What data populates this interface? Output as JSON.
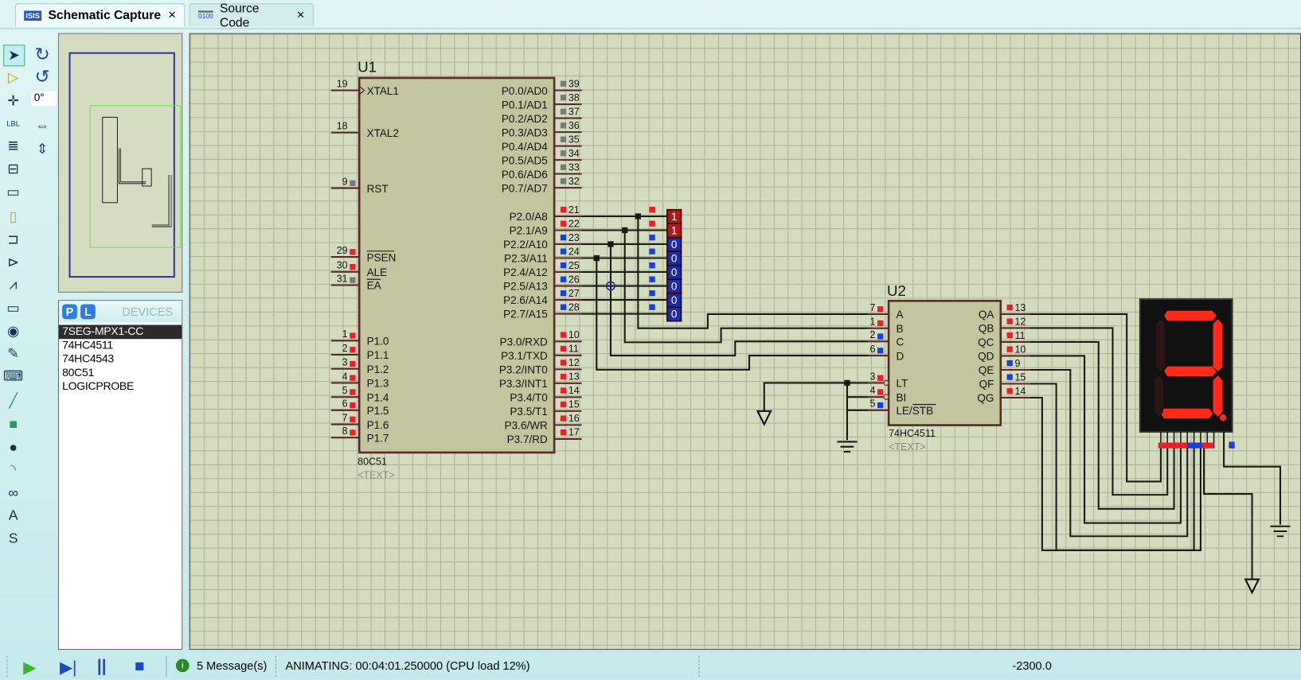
{
  "tabs": [
    {
      "label": "Schematic Capture",
      "icon": "isis-icon",
      "active": true
    },
    {
      "label": "Source Code",
      "icon": "source-code-icon",
      "active": false
    }
  ],
  "tab_close": "×",
  "rotation": "0°",
  "devices": {
    "title": "DEVICES",
    "p_label": "P",
    "l_label": "L",
    "items": [
      "7SEG-MPX1-CC",
      "74HC4511",
      "74HC4543",
      "80C51",
      "LOGICPROBE"
    ],
    "selected": "7SEG-MPX1-CC"
  },
  "toolbar": [
    "selection-mode",
    "component-mode",
    "junction-dot",
    "wire-label",
    "text-script",
    "buses",
    "subcircuit",
    "terminals",
    "device-pins",
    "graph",
    "tape-recorder",
    "generator",
    "voltage-probe",
    "virtual-instruments",
    "line-2d",
    "box-2d",
    "circle-2d",
    "arc-2d",
    "closed-path-2d",
    "text-2d",
    "symbol-2d",
    "marker-2d"
  ],
  "colors": {
    "high": "#e8202a",
    "low": "#1a3ee0",
    "float": "#7a7a7a",
    "segment_on": "#ff2a1a",
    "segment_off": "#2a1414"
  },
  "schematic": {
    "u1": {
      "ref": "U1",
      "part": "80C51",
      "text": "<TEXT>",
      "left_pins": [
        {
          "num": "19",
          "name": "XTAL1",
          "state": "none"
        },
        {
          "num": "18",
          "name": "XTAL2",
          "state": "none"
        },
        {
          "num": "9",
          "name": "RST",
          "state": "float"
        },
        {
          "num": "29",
          "name": "PSEN",
          "state": "high",
          "overline": true
        },
        {
          "num": "30",
          "name": "ALE",
          "state": "high"
        },
        {
          "num": "31",
          "name": "EA",
          "state": "float",
          "overline": true
        },
        {
          "num": "1",
          "name": "P1.0",
          "state": "high"
        },
        {
          "num": "2",
          "name": "P1.1",
          "state": "high"
        },
        {
          "num": "3",
          "name": "P1.2",
          "state": "high"
        },
        {
          "num": "4",
          "name": "P1.3",
          "state": "high"
        },
        {
          "num": "5",
          "name": "P1.4",
          "state": "high"
        },
        {
          "num": "6",
          "name": "P1.5",
          "state": "high"
        },
        {
          "num": "7",
          "name": "P1.6",
          "state": "high"
        },
        {
          "num": "8",
          "name": "P1.7",
          "state": "high"
        }
      ],
      "right_pins": [
        {
          "num": "39",
          "name": "P0.0/AD0",
          "state": "float"
        },
        {
          "num": "38",
          "name": "P0.1/AD1",
          "state": "float"
        },
        {
          "num": "37",
          "name": "P0.2/AD2",
          "state": "float"
        },
        {
          "num": "36",
          "name": "P0.3/AD3",
          "state": "float"
        },
        {
          "num": "35",
          "name": "P0.4/AD4",
          "state": "float"
        },
        {
          "num": "34",
          "name": "P0.5/AD5",
          "state": "float"
        },
        {
          "num": "33",
          "name": "P0.6/AD6",
          "state": "float"
        },
        {
          "num": "32",
          "name": "P0.7/AD7",
          "state": "float"
        },
        {
          "num": "21",
          "name": "P2.0/A8",
          "state": "high"
        },
        {
          "num": "22",
          "name": "P2.1/A9",
          "state": "high"
        },
        {
          "num": "23",
          "name": "P2.2/A10",
          "state": "low"
        },
        {
          "num": "24",
          "name": "P2.3/A11",
          "state": "low"
        },
        {
          "num": "25",
          "name": "P2.4/A12",
          "state": "low"
        },
        {
          "num": "26",
          "name": "P2.5/A13",
          "state": "low"
        },
        {
          "num": "27",
          "name": "P2.6/A14",
          "state": "low"
        },
        {
          "num": "28",
          "name": "P2.7/A15",
          "state": "low"
        },
        {
          "num": "10",
          "name": "P3.0/RXD",
          "state": "high"
        },
        {
          "num": "11",
          "name": "P3.1/TXD",
          "state": "high"
        },
        {
          "num": "12",
          "name": "P3.2/INT0",
          "state": "high"
        },
        {
          "num": "13",
          "name": "P3.3/INT1",
          "state": "high"
        },
        {
          "num": "14",
          "name": "P3.4/T0",
          "state": "high"
        },
        {
          "num": "15",
          "name": "P3.5/T1",
          "state": "high"
        },
        {
          "num": "16",
          "name": "P3.6/WR",
          "state": "high"
        },
        {
          "num": "17",
          "name": "P3.7/RD",
          "state": "high"
        }
      ]
    },
    "probes": [
      "1",
      "1",
      "0",
      "0",
      "0",
      "0",
      "0",
      "0"
    ],
    "u2": {
      "ref": "U2",
      "part": "74HC4511",
      "text": "<TEXT>",
      "left_pins": [
        {
          "num": "7",
          "name": "A",
          "state": "high"
        },
        {
          "num": "1",
          "name": "B",
          "state": "high"
        },
        {
          "num": "2",
          "name": "C",
          "state": "low"
        },
        {
          "num": "6",
          "name": "D",
          "state": "low"
        },
        {
          "num": "3",
          "name": "LT",
          "state": "high"
        },
        {
          "num": "4",
          "name": "BI",
          "state": "high"
        },
        {
          "num": "5",
          "name": "LE/STB",
          "state": "low"
        }
      ],
      "right_pins": [
        {
          "num": "13",
          "name": "QA",
          "state": "high"
        },
        {
          "num": "12",
          "name": "QB",
          "state": "high"
        },
        {
          "num": "11",
          "name": "QC",
          "state": "high"
        },
        {
          "num": "10",
          "name": "QD",
          "state": "high"
        },
        {
          "num": "9",
          "name": "QE",
          "state": "low"
        },
        {
          "num": "15",
          "name": "QF",
          "state": "low"
        },
        {
          "num": "14",
          "name": "QG",
          "state": "high"
        }
      ]
    },
    "display": {
      "digit": "3",
      "segments": {
        "a": true,
        "b": true,
        "c": true,
        "d": true,
        "e": false,
        "f": false,
        "g": true,
        "dp": true
      }
    }
  },
  "status": {
    "messages": "5 Message(s)",
    "state": "ANIMATING: 00:04:01.250000 (CPU load 12%)",
    "coord": "-2300.0"
  }
}
